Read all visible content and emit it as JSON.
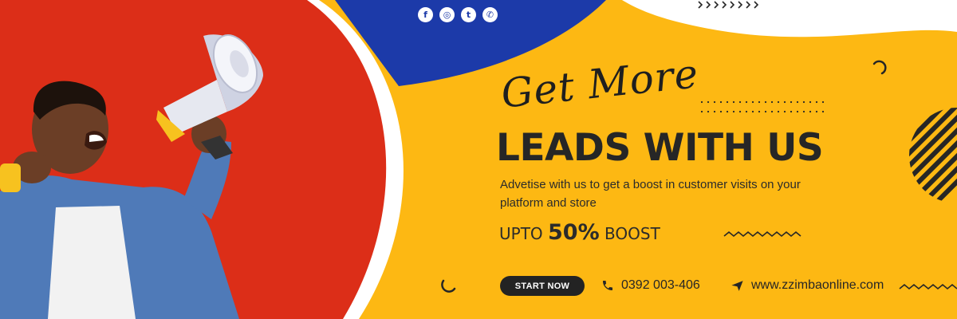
{
  "colors": {
    "red": "#dc2e18",
    "blue": "#1c3aa9",
    "yellow": "#fdb813",
    "dark": "#262626",
    "white": "#ffffff"
  },
  "social": {
    "icons": [
      {
        "name": "facebook-icon",
        "glyph": "f"
      },
      {
        "name": "instagram-icon",
        "glyph": "◎"
      },
      {
        "name": "twitter-icon",
        "glyph": "t"
      },
      {
        "name": "whatsapp-icon",
        "glyph": "✆"
      }
    ]
  },
  "hero": {
    "script_title": "Get More",
    "headline": "LEADS WITH US",
    "description": "Advetise with us to get a boost in customer visits on your platform and store",
    "boost_prefix": "UPTO ",
    "boost_percent": "50%",
    "boost_suffix": " BOOST"
  },
  "cta": {
    "start_label": "START NOW"
  },
  "contact": {
    "phone": "0392 003-406",
    "website": "www.zzimbaonline.com"
  }
}
